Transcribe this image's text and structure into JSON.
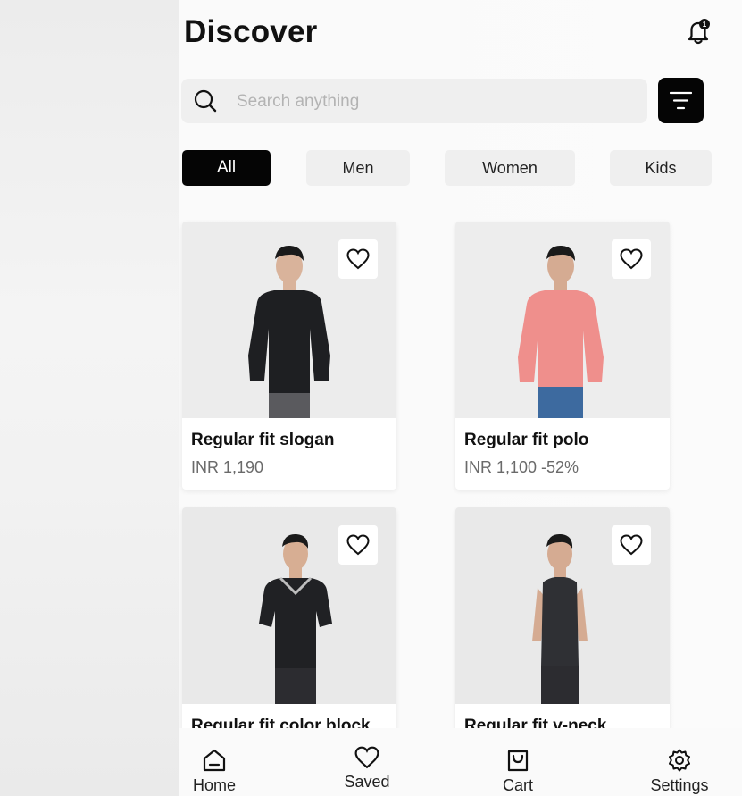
{
  "header": {
    "title": "Discover",
    "notification_count": "1"
  },
  "search": {
    "placeholder": "Search anything",
    "value": ""
  },
  "categories": [
    {
      "label": "All",
      "active": true
    },
    {
      "label": "Men",
      "active": false
    },
    {
      "label": "Women",
      "active": false
    },
    {
      "label": "Kids",
      "active": false
    }
  ],
  "products": [
    {
      "name": "Regular fit slogan",
      "price": "INR 1,190",
      "shirt_color": "#1e1f22",
      "pants_color": "#5a5a5e"
    },
    {
      "name": "Regular fit polo",
      "price": "INR 1,100  -52%",
      "shirt_color": "#ef8f8c",
      "pants_color": "#3d6a9f"
    },
    {
      "name": "Regular fit color block",
      "price": "",
      "shirt_color": "#202124",
      "pants_color": "#2c2c30"
    },
    {
      "name": "Regular fit v-neck",
      "price": "",
      "shirt_color": "#2f3034",
      "pants_color": "#2c2c30"
    }
  ],
  "bottom_nav": [
    {
      "label": "Home",
      "icon": "home-icon"
    },
    {
      "label": "Saved",
      "icon": "heart-icon"
    },
    {
      "label": "Cart",
      "icon": "bag-icon"
    },
    {
      "label": "Settings",
      "icon": "gear-icon"
    }
  ],
  "colors": {
    "accent": "#050505",
    "chip_bg": "#efefef",
    "price_text": "#6a6a6a"
  }
}
